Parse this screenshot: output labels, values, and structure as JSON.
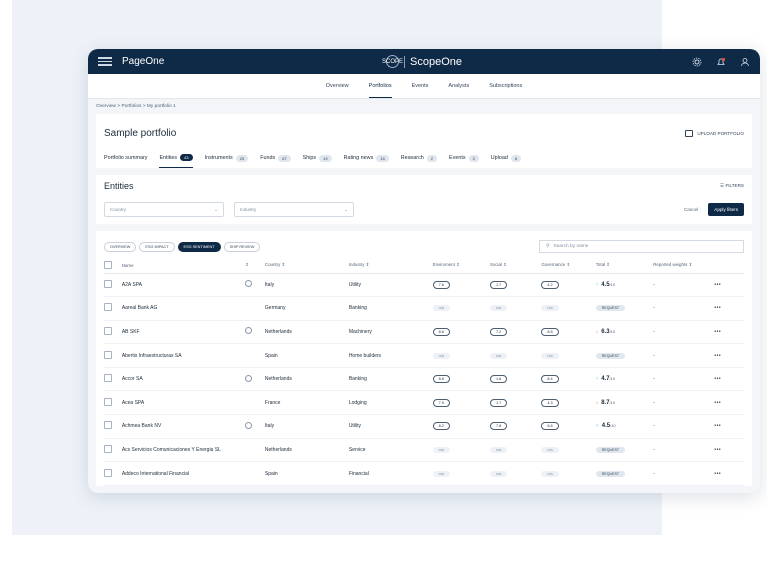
{
  "topbar": {
    "brand": "PageOne",
    "logo_text": "SCOPE",
    "product": "ScopeOne",
    "icons": [
      "menu-icon",
      "gear-icon",
      "bell-icon",
      "user-icon"
    ]
  },
  "nav": [
    "Overview",
    "Portfolios",
    "Events",
    "Analysts",
    "Subscriptions"
  ],
  "nav_active": "Portfolios",
  "breadcrumb": "Overview > Portfolios > My portfolio 1",
  "portfolio": {
    "title": "Sample portfolio",
    "upload_label": "UPLOAD PORTFOLIO"
  },
  "tabs": [
    {
      "label": "Portfolio summary",
      "count": ""
    },
    {
      "label": "Entities",
      "count": "43"
    },
    {
      "label": "Instruments",
      "count": "25"
    },
    {
      "label": "Funds",
      "count": "67"
    },
    {
      "label": "Ships",
      "count": "19"
    },
    {
      "label": "Rating news",
      "count": "15"
    },
    {
      "label": "Research",
      "count": "2"
    },
    {
      "label": "Events",
      "count": "3"
    },
    {
      "label": "Upload",
      "count": "6"
    }
  ],
  "entities": {
    "title": "Entities",
    "filters_label": "FILTERS",
    "country_placeholder": "Country",
    "industry_placeholder": "Industry",
    "cancel_label": "Cancel",
    "apply_label": "Apply filters",
    "views": [
      "OVERVIEW",
      "ESG IMPACT",
      "ESG SENTIMENT",
      "SHIP REVIEW"
    ],
    "active_view": "ESG SENTIMENT",
    "search_placeholder": "Search by name",
    "columns": [
      "Name",
      "Country",
      "Industry",
      "Enviroment",
      "Social",
      "Governance",
      "Total",
      "Reported weights"
    ]
  },
  "rows": [
    {
      "name": "A2A SPA",
      "person": true,
      "country": "Italy",
      "industry": "Utility",
      "env": "7.6",
      "soc": "1.7",
      "gov": "4.2",
      "trend": "up",
      "total": "4.5",
      "weights": "-"
    },
    {
      "name": "Aareal Bank AG",
      "person": false,
      "country": "Germany",
      "industry": "Banking",
      "env": "n/a",
      "soc": "n/a",
      "gov": "n/a",
      "trend": "request",
      "total": "REQUEST",
      "weights": "-"
    },
    {
      "name": "AB SKF",
      "person": true,
      "country": "Netherlands",
      "industry": "Machinery",
      "env": "8.6",
      "soc": "7.2",
      "gov": "8.5",
      "trend": "down",
      "total": "6.3",
      "weights": "-"
    },
    {
      "name": "Abertis Infraestructuras SA",
      "person": false,
      "country": "Spain",
      "industry": "Home builders",
      "env": "n/a",
      "soc": "n/a",
      "gov": "n/a",
      "trend": "request",
      "total": "REQUEST",
      "weights": "-"
    },
    {
      "name": "Accor SA",
      "person": true,
      "country": "Netherlands",
      "industry": "Banking",
      "env": "8.6",
      "soc": "1.6",
      "gov": "8.4",
      "trend": "up",
      "total": "4.7",
      "weights": "-"
    },
    {
      "name": "Acea SPA",
      "person": false,
      "country": "France",
      "industry": "Lodging",
      "env": "7.9",
      "soc": "1.7",
      "gov": "4.3",
      "trend": "down",
      "total": "8.7",
      "weights": "-"
    },
    {
      "name": "Achmea Bank NV",
      "person": true,
      "country": "Italy",
      "industry": "Utility",
      "env": "8.2",
      "soc": "7.8",
      "gov": "6.6",
      "trend": "flat",
      "total": "4.5",
      "weights": "-"
    },
    {
      "name": "Acs Servicios Comunicaciones Y Energia SL",
      "person": false,
      "country": "Netherlands",
      "industry": "Service",
      "env": "n/a",
      "soc": "n/a",
      "gov": "n/a",
      "trend": "request",
      "total": "REQUEST",
      "weights": "-"
    },
    {
      "name": "Addeco International Financial",
      "person": false,
      "country": "Spain",
      "industry": "Financial",
      "env": "n/a",
      "soc": "n/a",
      "gov": "n/a",
      "trend": "request",
      "total": "REQUEST",
      "weights": "-"
    }
  ],
  "total_suffix": "/10",
  "colors": {
    "navy": "#0e2a47",
    "up": "#2d9b57",
    "down": "#e0533c"
  }
}
